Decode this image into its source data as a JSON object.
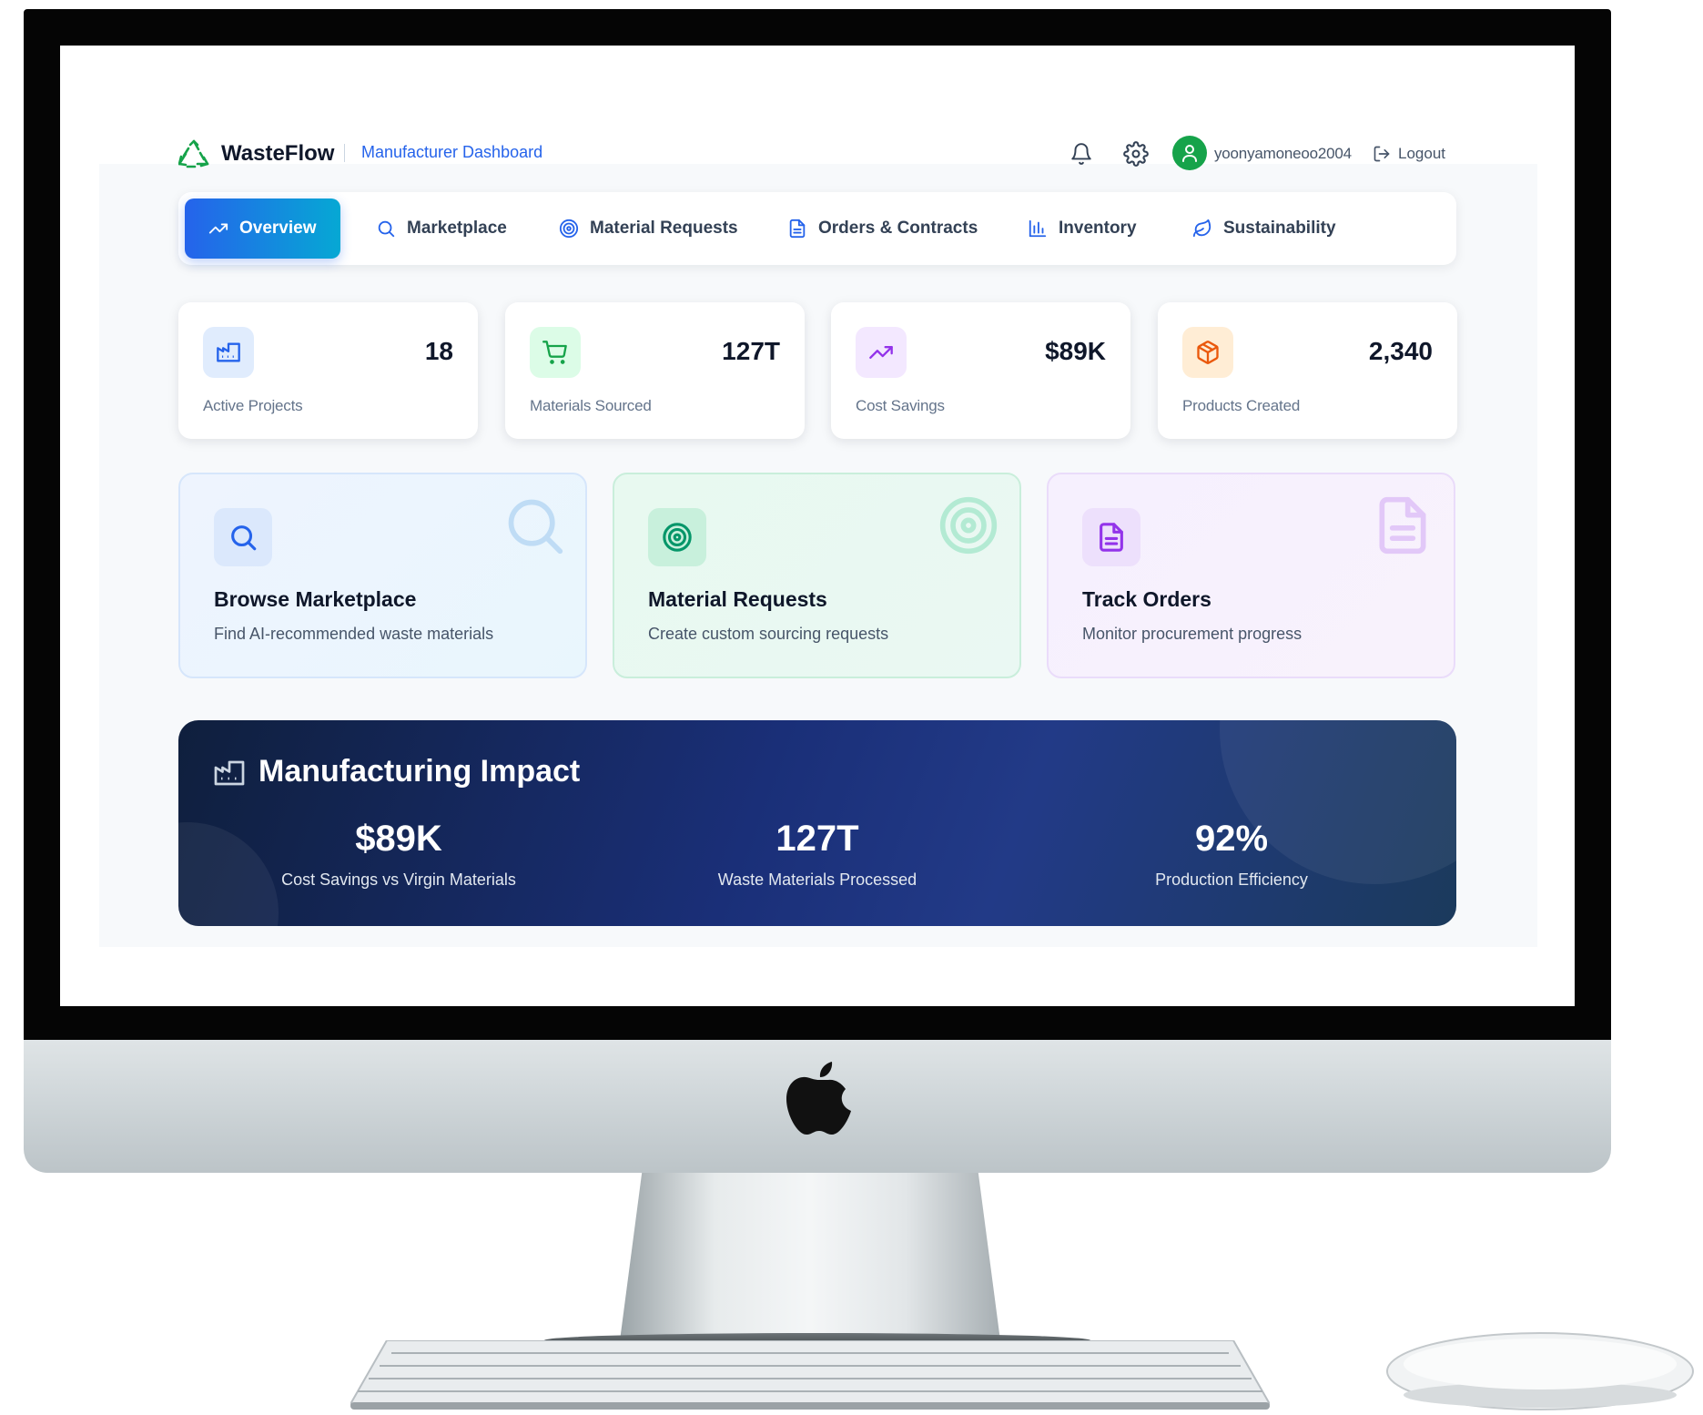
{
  "brand": {
    "name": "WasteFlow",
    "subtitle": "Manufacturer Dashboard"
  },
  "user": {
    "username": "yoonyamoneoo2004",
    "logout_label": "Logout"
  },
  "nav": {
    "tabs": [
      {
        "label": "Overview",
        "icon": "trending-up-icon",
        "active": true
      },
      {
        "label": "Marketplace",
        "icon": "search-icon",
        "active": false
      },
      {
        "label": "Material Requests",
        "icon": "target-icon",
        "active": false
      },
      {
        "label": "Orders & Contracts",
        "icon": "document-icon",
        "active": false
      },
      {
        "label": "Inventory",
        "icon": "bar-chart-icon",
        "active": false
      },
      {
        "label": "Sustainability",
        "icon": "leaf-icon",
        "active": false
      }
    ]
  },
  "stats": [
    {
      "value": "18",
      "label": "Active Projects",
      "icon": "factory-icon",
      "color": "#2563eb"
    },
    {
      "value": "127T",
      "label": "Materials Sourced",
      "icon": "cart-icon",
      "color": "#16a34a"
    },
    {
      "value": "$89K",
      "label": "Cost Savings",
      "icon": "trending-up-icon",
      "color": "#9333ea"
    },
    {
      "value": "2,340",
      "label": "Products Created",
      "icon": "package-icon",
      "color": "#ea580c"
    }
  ],
  "actions": [
    {
      "title": "Browse Marketplace",
      "description": "Find AI-recommended waste materials",
      "icon": "search-icon",
      "color": "#2563eb"
    },
    {
      "title": "Material Requests",
      "description": "Create custom sourcing requests",
      "icon": "target-icon",
      "color": "#059669"
    },
    {
      "title": "Track Orders",
      "description": "Monitor procurement progress",
      "icon": "document-icon",
      "color": "#9333ea"
    }
  ],
  "impact": {
    "title": "Manufacturing Impact",
    "metrics": [
      {
        "value": "$89K",
        "label": "Cost Savings vs Virgin Materials"
      },
      {
        "value": "127T",
        "label": "Waste Materials Processed"
      },
      {
        "value": "92%",
        "label": "Production Efficiency"
      }
    ]
  },
  "colors": {
    "accent": "#2563eb",
    "accent_gradient_end": "#06a8d4",
    "impact_bg": "#1a2f78",
    "avatar": "#16a34a"
  }
}
